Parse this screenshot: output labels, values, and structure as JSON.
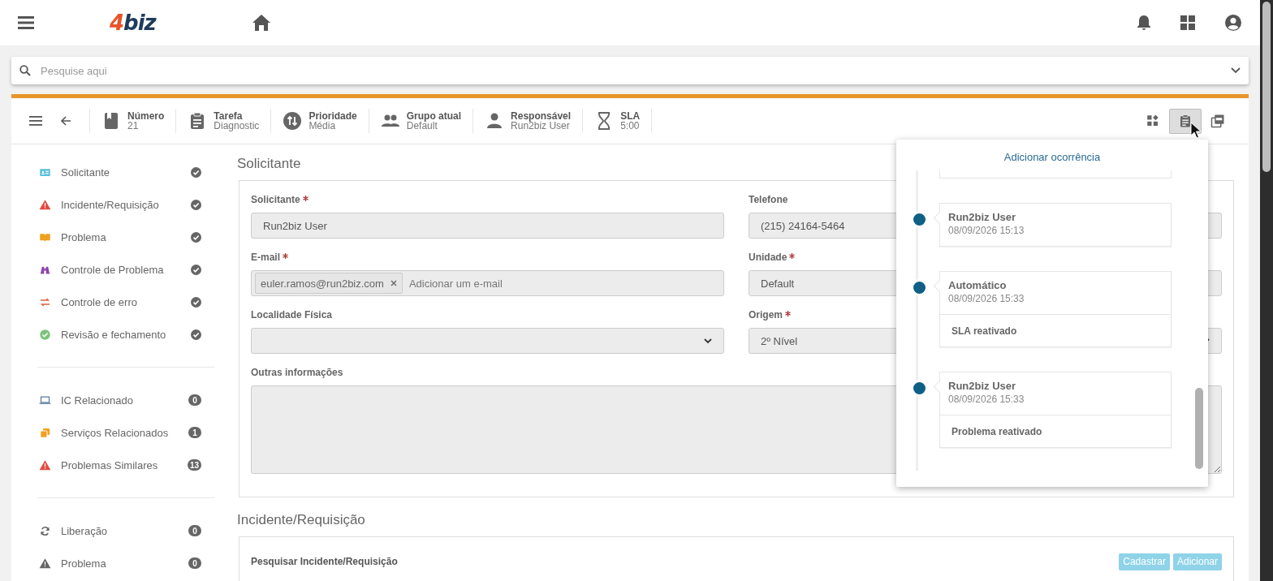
{
  "topbar": {
    "logo": "4biz"
  },
  "search": {
    "placeholder": "Pesquise aqui"
  },
  "toolbar": {
    "items": [
      {
        "label": "Número",
        "value": "21"
      },
      {
        "label": "Tarefa",
        "value": "Diagnostic"
      },
      {
        "label": "Prioridade",
        "value": "Média"
      },
      {
        "label": "Grupo atual",
        "value": "Default"
      },
      {
        "label": "Responsável",
        "value": "Run2biz User"
      },
      {
        "label": "SLA",
        "value": "5:00"
      }
    ],
    "actions": [
      {
        "selected": false
      },
      {
        "selected": true
      },
      {
        "selected": false
      }
    ]
  },
  "sidebar": {
    "groups": [
      {
        "items": [
          {
            "label": "Solicitante",
            "kind": "done"
          },
          {
            "label": "Incidente/Requisição",
            "kind": "done"
          },
          {
            "label": "Problema",
            "kind": "done"
          },
          {
            "label": "Controle de Problema",
            "kind": "done"
          },
          {
            "label": "Controle de erro",
            "kind": "done"
          },
          {
            "label": "Revisão e fechamento",
            "kind": "done"
          }
        ]
      },
      {
        "items": [
          {
            "label": "IC Relacionado",
            "kind": "count",
            "count": "0"
          },
          {
            "label": "Serviços Relacionados",
            "kind": "count",
            "count": "1"
          },
          {
            "label": "Problemas Similares",
            "kind": "count",
            "count": "13"
          }
        ]
      },
      {
        "items": [
          {
            "label": "Liberação",
            "kind": "count",
            "count": "0"
          },
          {
            "label": "Problema",
            "kind": "count",
            "count": "0"
          }
        ]
      }
    ]
  },
  "requester_section": {
    "title": "Solicitante",
    "left_fields": [
      {
        "kind": "text",
        "label": "Solicitante",
        "required": true,
        "value": "Run2biz User"
      },
      {
        "kind": "tags",
        "label": "E-mail",
        "required": true,
        "tags": [
          "euler.ramos@run2biz.com"
        ],
        "placeholder": "Adicionar um e-mail"
      },
      {
        "kind": "select",
        "label": "Localidade Física",
        "required": false
      }
    ],
    "right_fields": [
      {
        "kind": "text",
        "label": "Telefone",
        "required": false,
        "value": "(215) 24164-5464"
      },
      {
        "kind": "text",
        "label": "Unidade",
        "required": true,
        "value": "Default"
      },
      {
        "kind": "select",
        "label": "Origem",
        "required": true,
        "value": "2º Nível"
      }
    ],
    "notes": {
      "label": "Outras informações"
    }
  },
  "incident_section": {
    "title": "Incidente/Requisição",
    "search_label": "Pesquisar Incidente/Requisição",
    "buttons": [
      "Cadastrar",
      "Adicionar"
    ]
  },
  "occurrences_popover": {
    "title": "Adicionar ocorrência",
    "entries": [
      {
        "author": "Run2biz User",
        "date": "08/09/2026 15:13"
      },
      {
        "author": "Automático",
        "date": "08/09/2026 15:33",
        "note": "SLA reativado"
      },
      {
        "author": "Run2biz User",
        "date": "08/09/2026 15:33",
        "note": "Problema reativado"
      }
    ]
  }
}
